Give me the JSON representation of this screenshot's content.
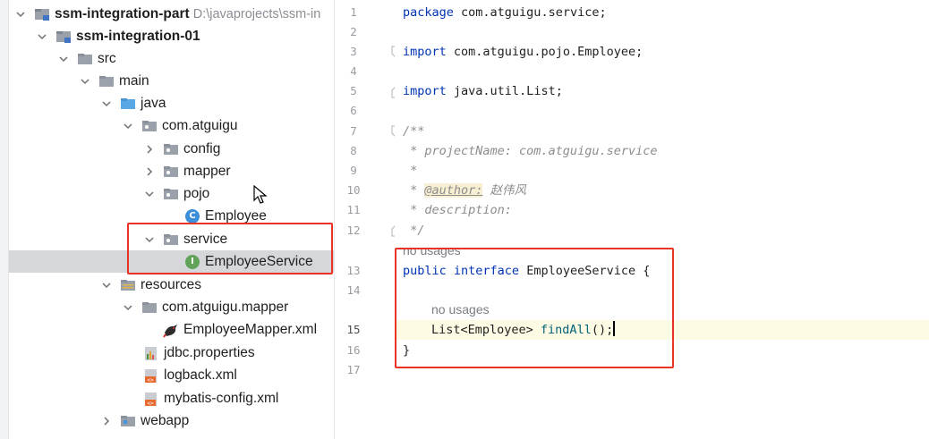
{
  "project_tree": {
    "root": {
      "label": "ssm-integration-part",
      "path": "D:\\javaprojects\\ssm-in"
    },
    "module": {
      "label": "ssm-integration-01"
    },
    "items": [
      {
        "label": "src"
      },
      {
        "label": "main"
      },
      {
        "label": "java"
      },
      {
        "label": "com.atguigu"
      },
      {
        "label": "config"
      },
      {
        "label": "mapper"
      },
      {
        "label": "pojo"
      },
      {
        "label": "Employee"
      },
      {
        "label": "service"
      },
      {
        "label": "EmployeeService"
      },
      {
        "label": "resources"
      },
      {
        "label": "com.atguigu.mapper"
      },
      {
        "label": "EmployeeMapper.xml"
      },
      {
        "label": "jdbc.properties"
      },
      {
        "label": "logback.xml"
      },
      {
        "label": "mybatis-config.xml"
      },
      {
        "label": "webapp"
      }
    ]
  },
  "editor": {
    "line_numbers": [
      "1",
      "2",
      "3",
      "4",
      "5",
      "6",
      "7",
      "8",
      "9",
      "10",
      "11",
      "12",
      "13",
      "14",
      "15",
      "16",
      "17"
    ],
    "current_line": "15",
    "lines": {
      "l1_kw": "package",
      "l1_rest": " com.atguigu.service;",
      "l3_kw": "import",
      "l3_rest": " com.atguigu.pojo.Employee;",
      "l5_kw": "import",
      "l5_rest": " java.util.List;",
      "l7": "/**",
      "l8": " * projectName: com.atguigu.service",
      "l9": " *",
      "l10_star": " * ",
      "l10_tag": "@author:",
      "l10_val": " 赵伟风",
      "l11": " * description:",
      "l12": " */",
      "l13_kw1": "public",
      "l13_kw2": " interface",
      "l13_rest": " EmployeeService {",
      "l15_type": "List<Employee>",
      "l15_meth": " findAll",
      "l15_rest": "();",
      "l16": "}"
    },
    "hints": {
      "usage_hint_1": "no usages",
      "usage_hint_2": "no usages"
    }
  },
  "colors": {
    "highlight_box": "#ea3323",
    "keyword": "#0033b3",
    "selection": "#d5d7db"
  }
}
